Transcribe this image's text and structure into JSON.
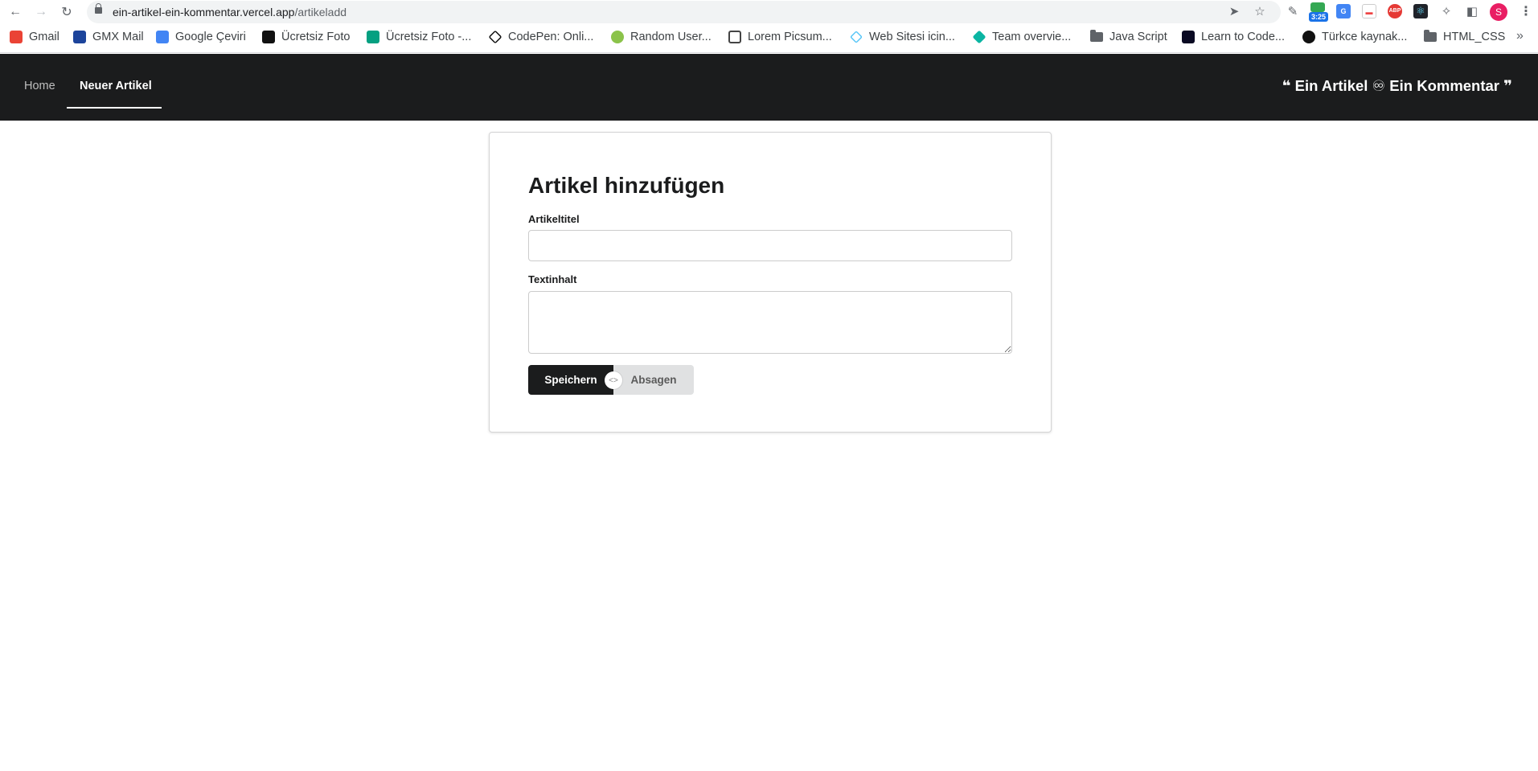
{
  "browser": {
    "url_host": "ein-artikel-ein-kommentar.vercel.app",
    "url_path": "/artikeladd",
    "extension_badge": "3:25",
    "extension_abp": "ABP",
    "avatar_letter": "S",
    "bookmarks": [
      {
        "label": "Gmail",
        "icon": "gmail-icon",
        "color": "#ea4335"
      },
      {
        "label": "GMX Mail",
        "icon": "gmx-icon",
        "color": "#1c449b"
      },
      {
        "label": "Google Çeviri",
        "icon": "google-translate-icon",
        "color": "#4285f4"
      },
      {
        "label": "Ücretsiz Foto",
        "icon": "unsplash-icon",
        "color": "#111111"
      },
      {
        "label": "Ücretsiz Foto -...",
        "icon": "pexels-icon",
        "color": "#05a081"
      },
      {
        "label": "CodePen: Onli...",
        "icon": "codepen-icon",
        "color": "#111111"
      },
      {
        "label": "Random User...",
        "icon": "random-user-icon",
        "color": "#8bc34a"
      },
      {
        "label": "Lorem Picsum...",
        "icon": "picsum-icon",
        "color": "#444444"
      },
      {
        "label": "Web Sitesi icin...",
        "icon": "diamond-outline-icon",
        "color": "#4fc3f7"
      },
      {
        "label": "Team overvie...",
        "icon": "team-diamond-icon",
        "color": "#0bb5a3"
      },
      {
        "label": "Java Script",
        "icon": "folder-icon",
        "color": "#5f6368"
      },
      {
        "label": "Learn to Code...",
        "icon": "freecodecamp-icon",
        "color": "#0a0a23"
      },
      {
        "label": "Türkce kaynak...",
        "icon": "github-icon",
        "color": "#111111"
      },
      {
        "label": "HTML_CSS",
        "icon": "folder-icon",
        "color": "#5f6368"
      }
    ]
  },
  "nav": {
    "home": "Home",
    "active": "Neuer Artikel",
    "brand": "❝ Ein Artikel ♾ Ein Kommentar ❞"
  },
  "form": {
    "title": "Artikel hinzufügen",
    "title_label": "Artikeltitel",
    "title_value": "",
    "body_label": "Textinhalt",
    "body_value": "",
    "save": "Speichern",
    "separator": "<>",
    "cancel": "Absagen"
  },
  "colors": {
    "appbar": "#1b1c1d",
    "save_button": "#1b1c1d",
    "cancel_button": "#e0e1e2"
  }
}
